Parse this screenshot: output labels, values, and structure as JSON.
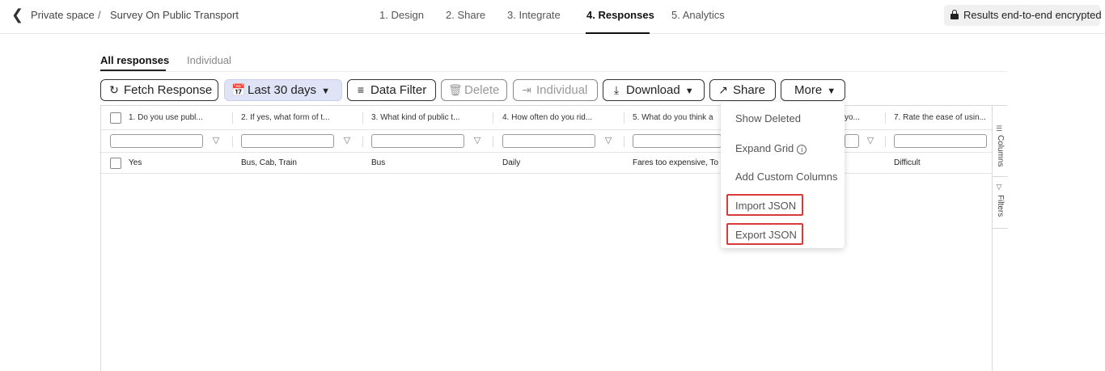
{
  "breadcrumb": {
    "workspace": "Private space",
    "separator": "/",
    "form": "Survey On Public Transport"
  },
  "steps": [
    {
      "label": "1. Design",
      "active": false
    },
    {
      "label": "2. Share",
      "active": false
    },
    {
      "label": "3. Integrate",
      "active": false
    },
    {
      "label": "4. Responses",
      "active": true
    },
    {
      "label": "5. Analytics",
      "active": false
    }
  ],
  "encryption_badge": "Results end-to-end encrypted",
  "subtabs": {
    "all": "All responses",
    "individual": "Individual"
  },
  "toolbar": {
    "fetch": "Fetch Response",
    "date_range": "Last 30 days",
    "data_filter": "Data Filter",
    "delete": "Delete",
    "individual": "Individual",
    "download": "Download",
    "share": "Share",
    "more": "More"
  },
  "grid": {
    "columns": [
      "1. Do you use publ...",
      "2. If yes, what form of t...",
      "3. What kind of public t...",
      "4. How often do you rid...",
      "5. What do you think a",
      "yo...",
      "7. Rate the ease of usin..."
    ],
    "rows": [
      [
        "Yes",
        "Bus, Cab, Train",
        "Bus",
        "Daily",
        "Fares too expensive, To",
        "",
        "Difficult"
      ]
    ],
    "side_tabs": {
      "columns": "Columns",
      "filters": "Filters"
    }
  },
  "more_menu": {
    "items": [
      {
        "label": "Show Deleted",
        "highlighted": false
      },
      {
        "label": "Expand Grid",
        "highlighted": false
      },
      {
        "label": "Add Custom Columns",
        "highlighted": false
      },
      {
        "label": "Import JSON",
        "highlighted": true
      },
      {
        "label": "Export JSON",
        "highlighted": true
      }
    ],
    "highlight_color": "#d93a3a"
  },
  "colors": {
    "date_button_bg": "#dfe3f6",
    "active_text": "#111111"
  }
}
